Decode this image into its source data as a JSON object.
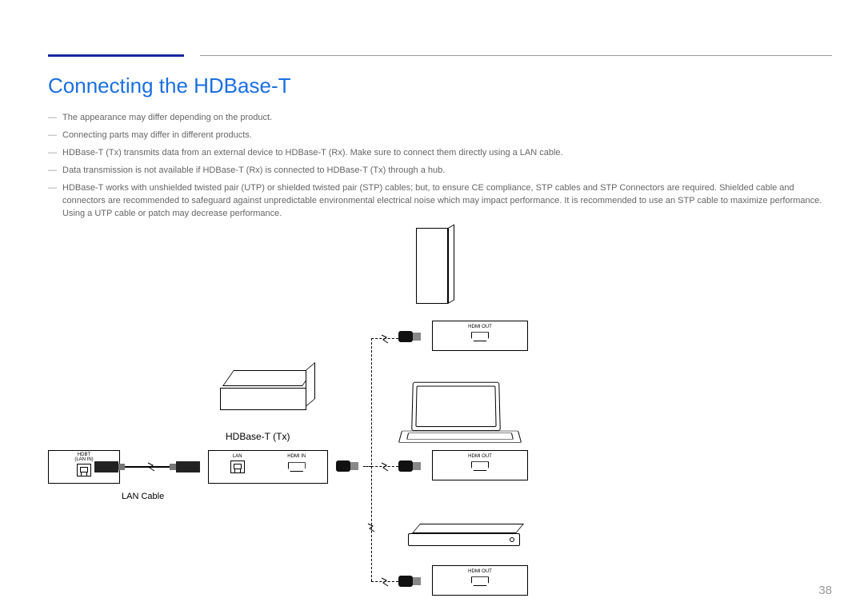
{
  "title": "Connecting the HDBase-T",
  "notes": [
    "The appearance may differ depending on the product.",
    "Connecting parts may differ in different products.",
    "HDBase-T (Tx) transmits data from an external device to HDBase-T (Rx). Make sure to connect them directly using a LAN cable.",
    "Data transmission is not available if HDBase-T (Rx) is connected to HDBase-T (Tx) through a hub.",
    "HDBase-T works with unshielded twisted pair (UTP) or shielded twisted pair (STP) cables; but, to ensure CE compliance, STP cables and STP Connectors are required. Shielded cable and connectors are recommended to safeguard against unpredictable environmental electrical noise which may impact performance. It is recommended to use an STP cable to maximize performance. Using a UTP cable or patch may decrease performance."
  ],
  "diagram": {
    "receiver_port_label": "HDBT\n(LAN IN)",
    "transmitter_label": "HDBase-T (Tx)",
    "transmitter_port_lan": "LAN",
    "transmitter_port_hdmi_in": "HDMI IN",
    "cable_label": "LAN Cable",
    "device_port_label": "HDMI  OUT"
  },
  "page_number": "38"
}
